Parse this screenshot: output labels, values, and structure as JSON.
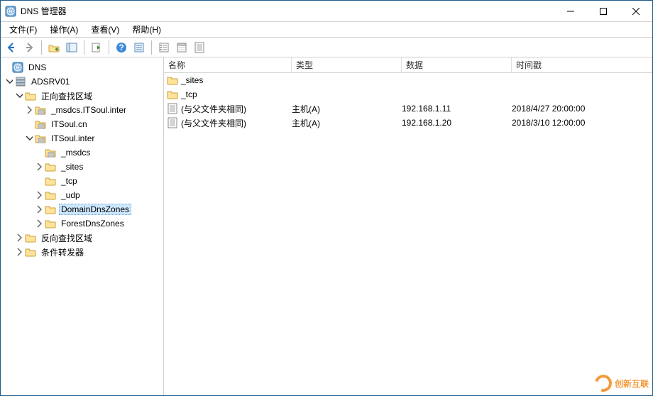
{
  "window": {
    "title": "DNS 管理器"
  },
  "menu": {
    "file": "文件(F)",
    "action": "操作(A)",
    "view": "查看(V)",
    "help": "帮助(H)"
  },
  "tree": {
    "root": "DNS",
    "server": "ADSRV01",
    "fwd": "正向查找区域",
    "rev": "反向查找区域",
    "cond": "条件转发器",
    "z_msdcs_inter": "_msdcs.ITSoul.inter",
    "z_itsoul_cn": "ITSoul.cn",
    "z_itsoul_inter": "ITSoul.inter",
    "s_msdcs": "_msdcs",
    "s_sites": "_sites",
    "s_tcp": "_tcp",
    "s_udp": "_udp",
    "s_ddz": "DomainDnsZones",
    "s_fdz": "ForestDnsZones"
  },
  "columns": {
    "name": "名称",
    "type": "类型",
    "data": "数据",
    "ts": "时间戳"
  },
  "rows": [
    {
      "icon": "folder",
      "name": "_sites",
      "type": "",
      "data": "",
      "ts": ""
    },
    {
      "icon": "folder",
      "name": "_tcp",
      "type": "",
      "data": "",
      "ts": ""
    },
    {
      "icon": "record",
      "name": "(与父文件夹相同)",
      "type": "主机(A)",
      "data": "192.168.1.11",
      "ts": "2018/4/27 20:00:00"
    },
    {
      "icon": "record",
      "name": "(与父文件夹相同)",
      "type": "主机(A)",
      "data": "192.168.1.20",
      "ts": "2018/3/10 12:00:00"
    }
  ],
  "watermark": "创新互联"
}
